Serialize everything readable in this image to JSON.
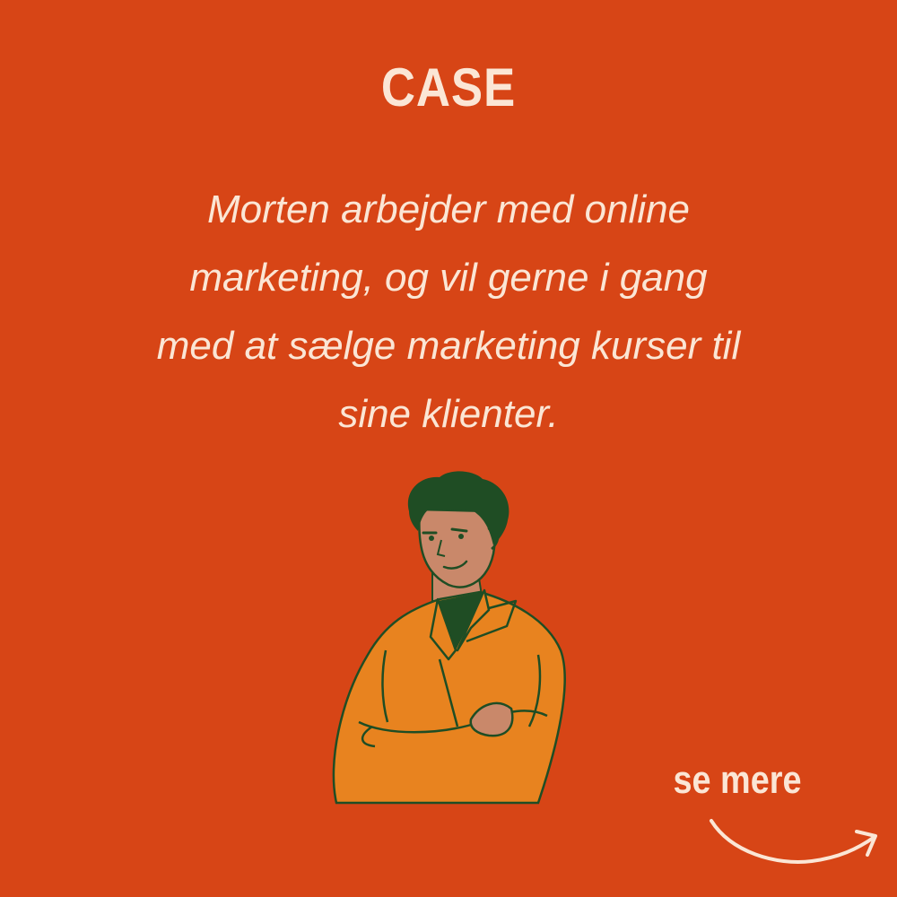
{
  "title": "CASE",
  "body_lines": [
    "Morten arbejder med online",
    "marketing, og vil gerne i gang",
    "med at sælge marketing kurser til",
    "sine klienter."
  ],
  "cta": {
    "label": "se mere",
    "icon": "curved-arrow-right-icon"
  },
  "illustration": {
    "icon": "man-arms-crossed-illustration"
  },
  "colors": {
    "background": "#d74516",
    "text": "#fbe6d5",
    "jacket": "#e8831f",
    "skin": "#c9886a",
    "hair_and_lines": "#1f4d24"
  }
}
